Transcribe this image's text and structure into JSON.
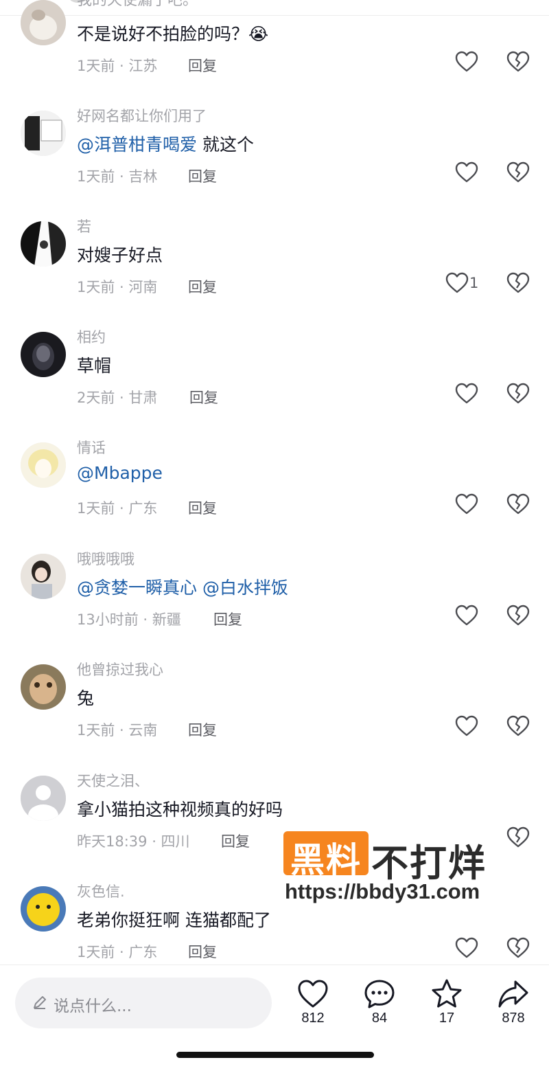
{
  "top_partial_text": "我的天使漏了吧。",
  "comments": [
    {
      "username": "",
      "text": "不是说好不拍脸的吗？",
      "emoji": "😭",
      "time": "1天前 · 江苏",
      "reply": "回复",
      "likes": ""
    },
    {
      "username": "好网名都让你们用了",
      "mention": "@洱普柑青喝爱",
      "text": " 就这个",
      "time": "1天前 · 吉林",
      "reply": "回复",
      "likes": ""
    },
    {
      "username": "若",
      "text": "对嫂子好点",
      "time": "1天前 · 河南",
      "reply": "回复",
      "likes": "1"
    },
    {
      "username": "相约",
      "text": "草帽",
      "time": "2天前 · 甘肃",
      "reply": "回复",
      "likes": ""
    },
    {
      "username": "情话",
      "mention": "@Mbappe",
      "text": "",
      "time": "1天前 · 广东",
      "reply": "回复",
      "likes": ""
    },
    {
      "username": "哦哦哦哦",
      "mention": "@贪婪一瞬真心",
      "mention2": "@白水拌饭",
      "text": "",
      "time": "13小时前 · 新疆",
      "reply": "回复",
      "likes": ""
    },
    {
      "username": "他曾掠过我心",
      "text": "兔",
      "time": "1天前 · 云南",
      "reply": "回复",
      "likes": ""
    },
    {
      "username": "天使之泪、",
      "text": "拿小猫拍这种视频真的好吗",
      "time": "昨天18:39 · 四川",
      "reply": "回复",
      "likes": ""
    },
    {
      "username": "灰色信.",
      "text": "老弟你挺狂啊 连猫都配了",
      "time": "1天前 · 广东",
      "reply": "回复",
      "likes": ""
    }
  ],
  "bottom_bar": {
    "input_placeholder": "说点什么...",
    "like_count": "812",
    "comment_count": "84",
    "favorite_count": "17",
    "share_count": "878"
  },
  "watermark": {
    "badge": "黑料",
    "title": "不打烊",
    "url": "https://bbdy31.com"
  },
  "colors": {
    "mention": "#1f5fa8",
    "watermark_orange": "#f6851f",
    "muted_text": "#a2a3a8"
  }
}
